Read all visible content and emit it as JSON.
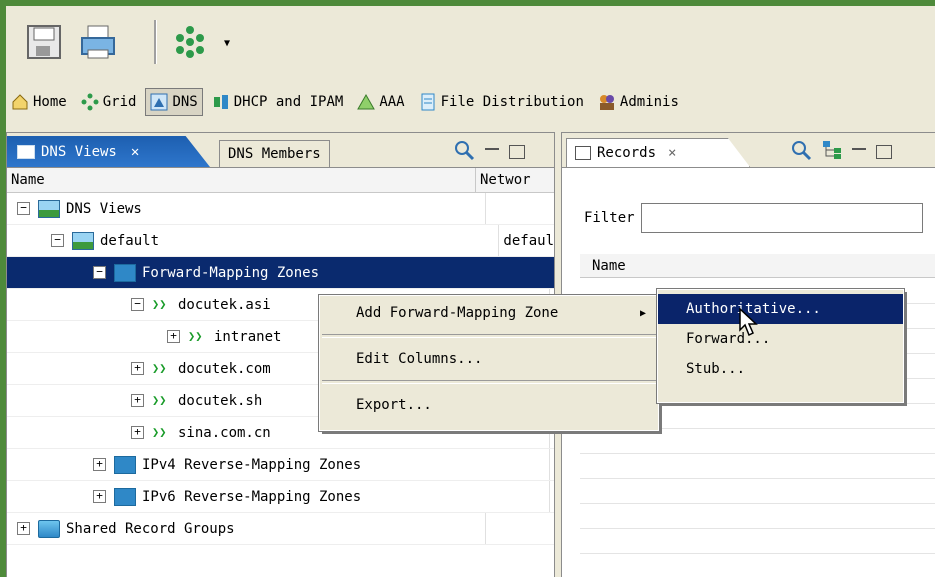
{
  "toolbar": {
    "save": "save-icon",
    "print": "print-icon",
    "grid": "grid-icon"
  },
  "perspectives": [
    {
      "label": "Home",
      "icon": "home-icon",
      "active": false
    },
    {
      "label": "Grid",
      "icon": "grid-icon",
      "active": false
    },
    {
      "label": "DNS",
      "icon": "dns-icon",
      "active": true
    },
    {
      "label": "DHCP and IPAM",
      "icon": "dhcp-icon",
      "active": false
    },
    {
      "label": "AAA",
      "icon": "aaa-icon",
      "active": false
    },
    {
      "label": "File Distribution",
      "icon": "file-icon",
      "active": false
    },
    {
      "label": "Adminis",
      "icon": "admin-icon",
      "active": false
    }
  ],
  "left_panel": {
    "tab_active": "DNS Views",
    "tab_inactive": "DNS Members",
    "columns": [
      "Name",
      "Networ"
    ]
  },
  "tree": [
    {
      "label": "DNS Views",
      "exp": "−",
      "net": ""
    },
    {
      "label": "default",
      "exp": "−",
      "net": "defaul"
    },
    {
      "label": "Forward-Mapping Zones",
      "exp": "−",
      "net": ""
    },
    {
      "label": "docutek.asi",
      "exp": "−",
      "net": ""
    },
    {
      "label": "intranet",
      "exp": "+",
      "net": ""
    },
    {
      "label": "docutek.com",
      "exp": "+",
      "net": ""
    },
    {
      "label": "docutek.sh",
      "exp": "+",
      "net": ""
    },
    {
      "label": "sina.com.cn",
      "exp": "+",
      "net": ""
    },
    {
      "label": "IPv4 Reverse-Mapping Zones",
      "exp": "+",
      "net": ""
    },
    {
      "label": "IPv6 Reverse-Mapping Zones",
      "exp": "+",
      "net": ""
    },
    {
      "label": "Shared Record Groups",
      "exp": "+",
      "net": ""
    }
  ],
  "right_panel": {
    "tab": "Records",
    "filter_label": "Filter",
    "filter_value": "",
    "column": "Name"
  },
  "context_menu": {
    "items": [
      "Add Forward-Mapping Zone",
      "Edit Columns...",
      "Export..."
    ]
  },
  "submenu": {
    "items": [
      "Authoritative...",
      "Forward...",
      "Stub..."
    ]
  }
}
